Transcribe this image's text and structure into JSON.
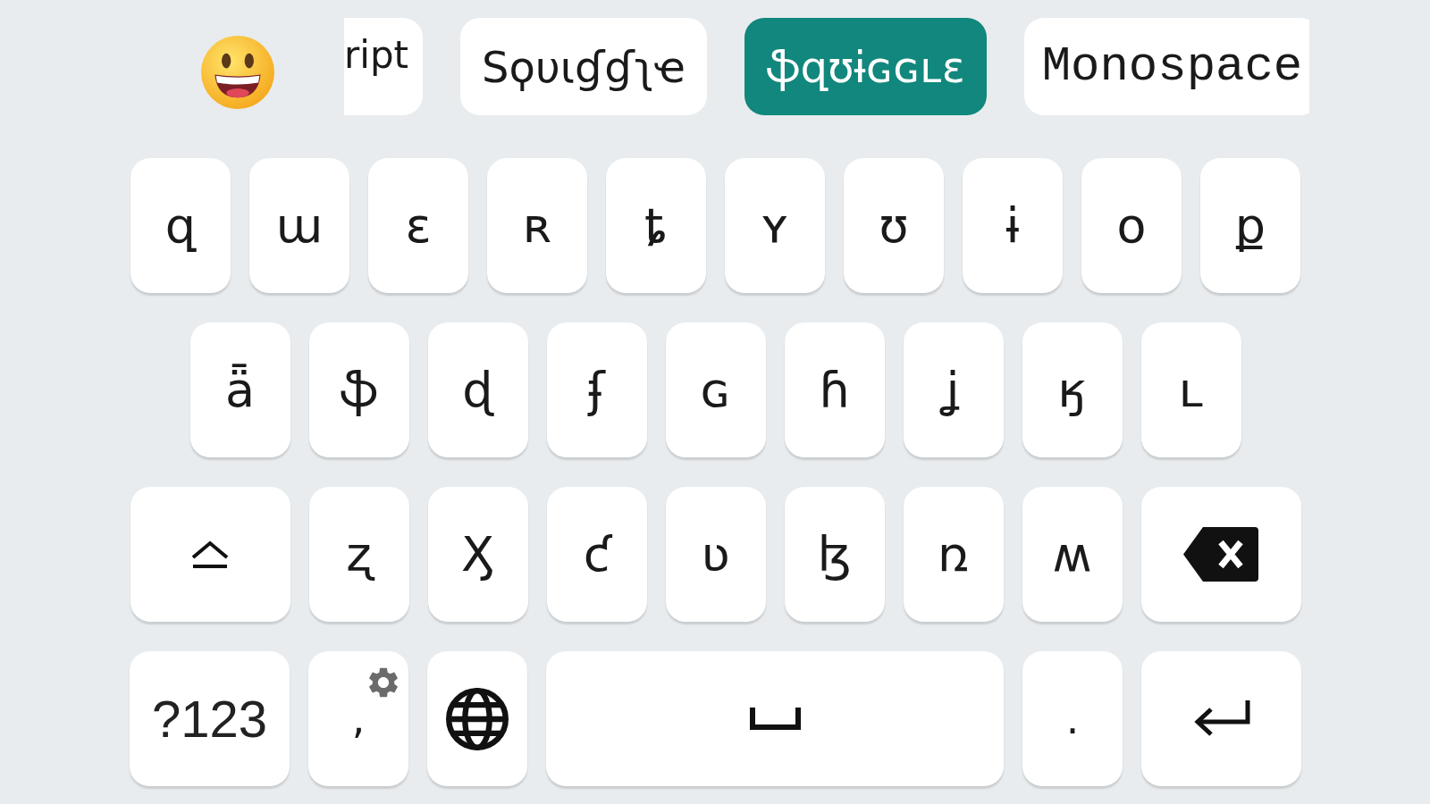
{
  "suggestion_bar": {
    "font_chips": [
      {
        "label": "ript",
        "kind": "sans",
        "selected": false
      },
      {
        "label": "Sϙυιɠɠʅҽ",
        "kind": "sans",
        "selected": false
      },
      {
        "label": "ֆզʊɨɢɢʟɛ",
        "kind": "sans",
        "selected": true
      },
      {
        "label": "Monospace",
        "kind": "mono",
        "selected": false
      }
    ]
  },
  "keyboard": {
    "key_rows": [
      {
        "keys": [
          {
            "kind": "letter",
            "label": "զ"
          },
          {
            "kind": "letter",
            "label": "ա"
          },
          {
            "kind": "letter",
            "label": "ɛ"
          },
          {
            "kind": "letter",
            "label": "ʀ"
          },
          {
            "kind": "letter",
            "label": "ȶ"
          },
          {
            "kind": "letter",
            "label": "ʏ"
          },
          {
            "kind": "letter",
            "label": "ʊ"
          },
          {
            "kind": "letter",
            "label": "ɨ"
          },
          {
            "kind": "letter",
            "label": "օ"
          },
          {
            "kind": "letter",
            "label": "ք"
          }
        ]
      },
      {
        "keys": [
          {
            "kind": "letter",
            "label": "ǟ"
          },
          {
            "kind": "letter",
            "label": "ֆ"
          },
          {
            "kind": "letter",
            "label": "ɖ"
          },
          {
            "kind": "letter",
            "label": "ʄ"
          },
          {
            "kind": "letter",
            "label": "ɢ"
          },
          {
            "kind": "letter",
            "label": "ɦ"
          },
          {
            "kind": "letter",
            "label": "ʝ"
          },
          {
            "kind": "letter",
            "label": "ӄ"
          },
          {
            "kind": "letter",
            "label": "ʟ"
          }
        ]
      },
      {
        "keys": [
          {
            "kind": "shift"
          },
          {
            "kind": "letter",
            "label": "ʐ"
          },
          {
            "kind": "letter",
            "label": "Ӽ"
          },
          {
            "kind": "letter",
            "label": "ƈ"
          },
          {
            "kind": "letter",
            "label": "ʋ"
          },
          {
            "kind": "letter",
            "label": "ɮ"
          },
          {
            "kind": "letter",
            "label": "ռ"
          },
          {
            "kind": "letter",
            "label": "ʍ"
          },
          {
            "kind": "backspace"
          }
        ]
      },
      {
        "keys": [
          {
            "kind": "symbols",
            "label": "?123"
          },
          {
            "kind": "comma",
            "label": ","
          },
          {
            "kind": "globe"
          },
          {
            "kind": "space"
          },
          {
            "kind": "period",
            "label": "."
          },
          {
            "kind": "enter"
          }
        ]
      }
    ]
  }
}
